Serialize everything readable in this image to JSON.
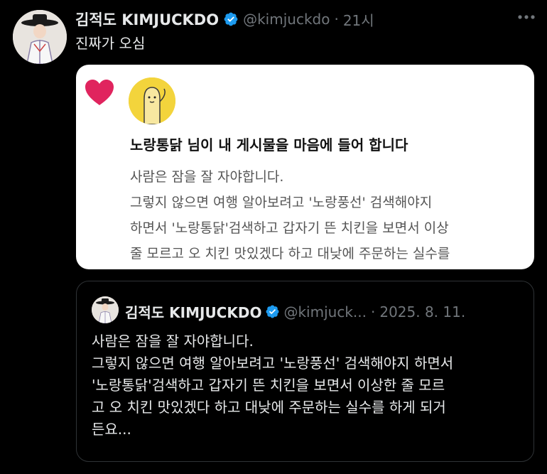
{
  "tweet": {
    "author_name": "김적도 KIMJUCKDO",
    "handle": "@kimjuckdo",
    "separator": "·",
    "time": "21시",
    "text": "진짜가 오심",
    "verified_icon": "verified-badge-icon",
    "more_icon": "more-dots-icon"
  },
  "screenshot": {
    "title": "노랑통닭 님이 내 게시물을 마음에 들어 합니다",
    "body_lines": [
      "사람은 잠을 잘 자야합니다.",
      "그렇지 않으면 여행 알아보려고 '노랑풍선' 검색해야지",
      "하면서 '노랑통닭'검색하고 갑자기 뜬 치킨을 보면서 이상",
      "줄 모르고 오 치킨 맛있겠다 하고 대낮에 주문하는 실수를"
    ],
    "heart_icon": "heart-icon",
    "heart_color": "#e0245e",
    "avatar_color": "#f3d43c"
  },
  "quote": {
    "author_name": "김적도 KIMJUCKDO",
    "handle": "@kimjuck...",
    "separator": "·",
    "date": "2025. 8. 11.",
    "body_lines": [
      "사람은 잠을 잘 자야합니다.",
      "그렇지 않으면 여행 알아보려고 '노랑풍선' 검색해야지 하면서",
      "'노랑통닭'검색하고 갑자기 뜬 치킨을 보면서 이상한 줄 모르",
      "고 오 치킨 맛있겠다 하고 대낮에 주문하는 실수를 하게 되거",
      "든요..."
    ]
  },
  "colors": {
    "background": "#000000",
    "text": "#e7e9ea",
    "muted": "#71767b",
    "verified": "#1d9bf0"
  }
}
